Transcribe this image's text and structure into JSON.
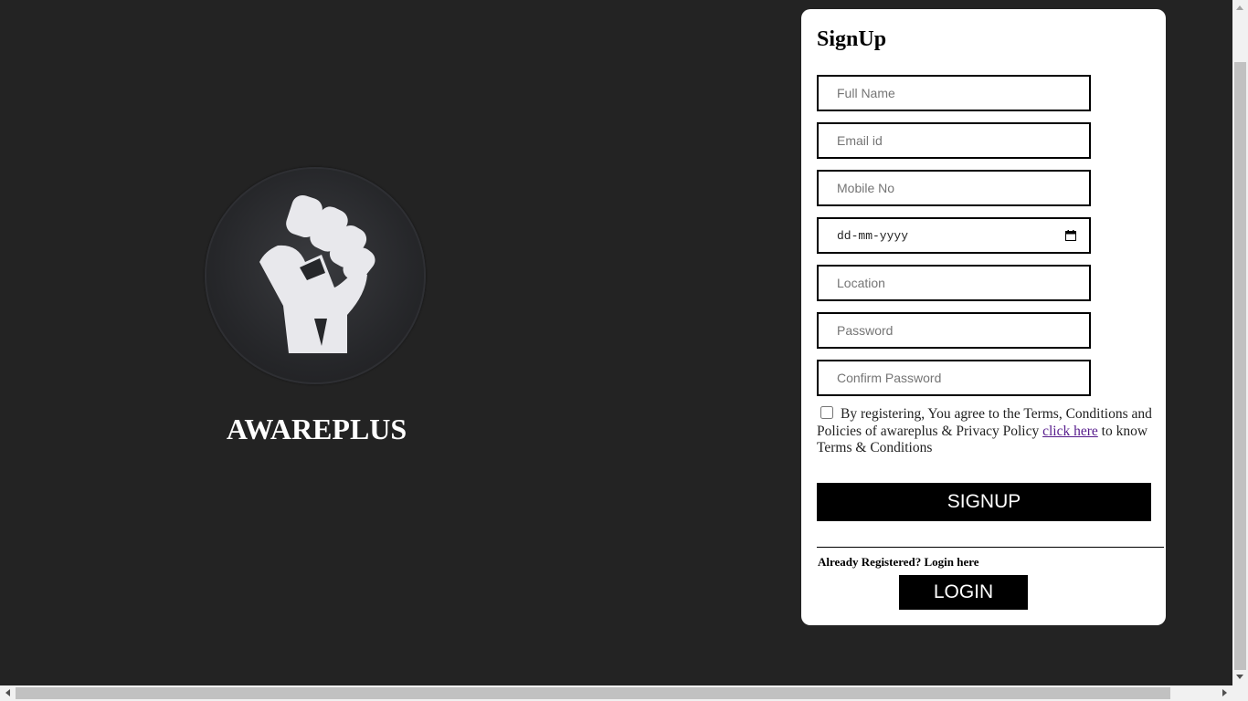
{
  "brand": {
    "name": "AWAREPLUS",
    "logo_icon": "raised-fist-icon"
  },
  "signup": {
    "title": "SignUp",
    "fields": {
      "full_name": {
        "placeholder": "Full Name",
        "value": ""
      },
      "email": {
        "placeholder": "Email id",
        "value": ""
      },
      "mobile": {
        "placeholder": "Mobile No",
        "value": ""
      },
      "dob": {
        "display": "dd-mm-yyyy",
        "value": ""
      },
      "location": {
        "placeholder": "Location",
        "value": ""
      },
      "password": {
        "placeholder": "Password",
        "value": ""
      },
      "confirm_password": {
        "placeholder": "Confirm Password",
        "value": ""
      }
    },
    "terms": {
      "checked": false,
      "text_before": "By registering, You agree to the Terms, Conditions and Policies of awareplus & Privacy Policy ",
      "link_text": "click here",
      "text_after": " to know Terms & Conditions"
    },
    "signup_button": "SIGNUP",
    "divider": "________________________________________________________",
    "already_registered": "Already Registered? Login here",
    "login_button": "LOGIN"
  },
  "colors": {
    "background": "#232323",
    "card": "#ffffff",
    "button": "#000000",
    "link": "#551a8b"
  }
}
